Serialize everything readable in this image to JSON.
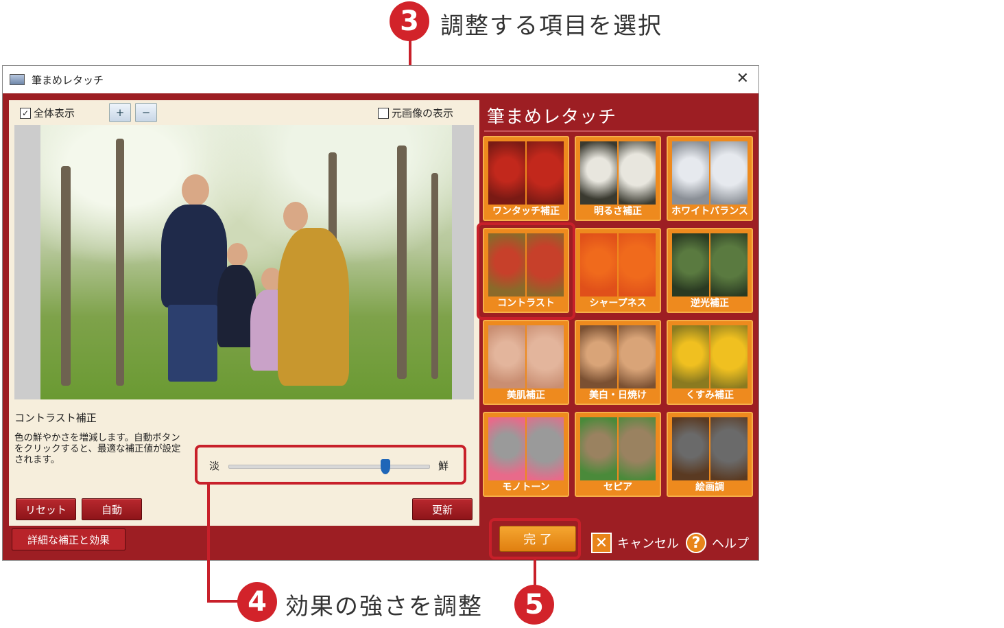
{
  "callouts": {
    "c3": {
      "num": "3",
      "text": "調整する項目を選択"
    },
    "c4": {
      "num": "4",
      "text": "効果の強さを調整"
    },
    "c5": {
      "num": "5"
    }
  },
  "window": {
    "title": "筆まめレタッチ",
    "close": "✕"
  },
  "left": {
    "show_all_label": "全体表示",
    "show_original_label": "元画像の表示",
    "zoom_in": "+",
    "zoom_out": "−",
    "correction_title": "コントラスト補正",
    "correction_desc": "色の鮮やかさを増減します。自動ボタンをクリックすると、最適な補正値が設定されます。",
    "slider": {
      "min_label": "淡",
      "max_label": "鮮",
      "value": 0.78
    },
    "reset": "リセット",
    "auto": "自動",
    "update": "更新",
    "detail": "詳細な補正と効果"
  },
  "right": {
    "title": "筆まめレタッチ",
    "tiles": [
      {
        "label": "ワンタッチ補正",
        "icon": "strawberry-thumb",
        "colors": [
          "#7a1a14",
          "#c2281c"
        ]
      },
      {
        "label": "明るさ補正",
        "icon": "flower-thumb",
        "colors": [
          "#3a3a30",
          "#e8e6de"
        ]
      },
      {
        "label": "ホワイトバランス",
        "icon": "snow-thumb",
        "colors": [
          "#8a8f96",
          "#e6e9ee"
        ]
      },
      {
        "label": "コントラスト",
        "icon": "fruit-stand-thumb",
        "colors": [
          "#8a6a2a",
          "#c7402a"
        ]
      },
      {
        "label": "シャープネス",
        "icon": "orange-flower-thumb",
        "colors": [
          "#e0501a",
          "#f06a1c"
        ]
      },
      {
        "label": "逆光補正",
        "icon": "leaf-thumb",
        "colors": [
          "#2a3a22",
          "#5a7a40"
        ]
      },
      {
        "label": "美肌補正",
        "icon": "woman-face-thumb",
        "colors": [
          "#c98e72",
          "#e3b59c"
        ]
      },
      {
        "label": "美白・日焼け",
        "icon": "boy-face-thumb",
        "colors": [
          "#7a5032",
          "#d9a478"
        ]
      },
      {
        "label": "くすみ補正",
        "icon": "sunflower-thumb",
        "colors": [
          "#8a7a20",
          "#f0c020"
        ]
      },
      {
        "label": "モノトーン",
        "icon": "bouquet-thumb",
        "colors": [
          "#e86a8a",
          "#9a9a9a"
        ]
      },
      {
        "label": "セピア",
        "icon": "palm-thumb",
        "colors": [
          "#4a8a3a",
          "#9a8260"
        ]
      },
      {
        "label": "絵画調",
        "icon": "waterwheel-thumb",
        "colors": [
          "#5a3a22",
          "#6a6a6a"
        ]
      }
    ],
    "done": "完 了",
    "cancel": "キャンセル",
    "cancel_icon": "✕",
    "help": "ヘルプ",
    "help_icon": "?"
  }
}
